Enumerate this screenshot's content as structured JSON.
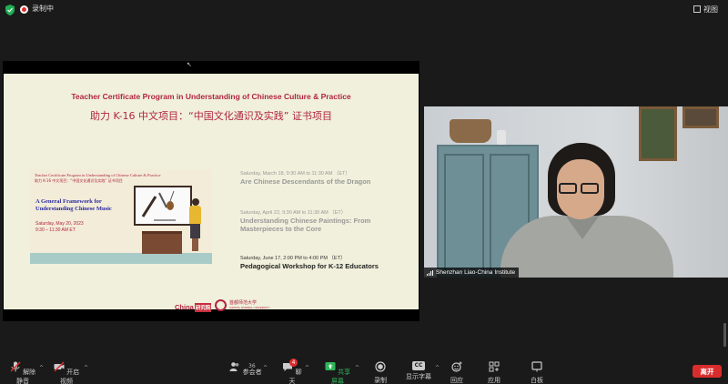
{
  "topbar": {
    "recording_label": "录制中",
    "view_label": "视图",
    "icons": {
      "security": "shield-check-icon",
      "recording": "record-dot-icon",
      "view": "grid-view-icon"
    },
    "colors": {
      "security": "#1fae56",
      "recording": "#e02b2b"
    }
  },
  "slide": {
    "title": "Teacher Certificate Program in Understanding of Chinese Culture & Practice",
    "subtitle": "助力 K-16 中文项目：“中国文化通识及实践” 证书项目",
    "poster": {
      "line1": "Teacher Certificate Program in Understanding of Chinese Culture & Practice",
      "line2": "助力 K-16 中文项目：“中国文化通识及实践” 证书项目",
      "heading": "A General Framework for Understanding Chinese Music",
      "date": "Saturday, May 20, 2023",
      "time": "9:30 – 11:30 AM ET"
    },
    "events": [
      {
        "date": "Saturday, March 18, 9:30 AM to 11:30 AM （ET）",
        "name": "Are Chinese Descendants of the Dragon"
      },
      {
        "date": "Saturday, April 22, 9:30 AM to 11:30 AM （ET）",
        "name": "Understanding Chinese Paintings: From Masterpieces to the Core"
      },
      {
        "date": "Saturday, June 17, 2:00 PM to 4:00 PM （ET）",
        "name": "Pedagogical Workshop for K-12 Educators"
      }
    ],
    "logo_china_text": "China",
    "logo_china_badge": "研究院",
    "logo_uni_text": "首都师范大学",
    "logo_uni_sub": "CAPITAL NORMAL UNIVERSITY"
  },
  "video": {
    "participant_name": "Shenzhan Liao-China Institute"
  },
  "toolbar": {
    "mute_label": "解除静音",
    "video_label": "开启视频",
    "participants_label": "参会者",
    "participants_count": "36",
    "chat_label": "聊天",
    "chat_badge": "4",
    "share_label": "共享屏幕",
    "record_label": "录制",
    "captions_label": "显示字幕",
    "captions_badge": "CC",
    "reactions_label": "回应",
    "apps_label": "应用",
    "whiteboard_label": "白板",
    "leave_label": "离开",
    "colors": {
      "share": "#2fb65a",
      "leave": "#d92d2d",
      "muted": "#e02b2b"
    }
  }
}
